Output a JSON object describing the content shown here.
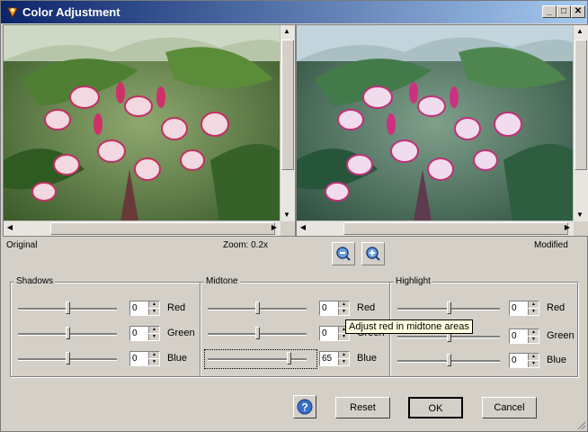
{
  "window": {
    "title": "Color Adjustment"
  },
  "titlebar_buttons": [
    "_",
    "□",
    "✕"
  ],
  "preview": {
    "left_caption": "Original",
    "zoom_label": "Zoom: 0.2x",
    "right_caption": "Modified"
  },
  "groups": {
    "shadows": {
      "label": "Shadows",
      "rows": [
        {
          "value": "0",
          "label": "Red",
          "level": 0.5
        },
        {
          "value": "0",
          "label": "Green",
          "level": 0.5
        },
        {
          "value": "0",
          "label": "Blue",
          "level": 0.5
        }
      ]
    },
    "midtone": {
      "label": "Midtone",
      "rows": [
        {
          "value": "0",
          "label": "Red",
          "level": 0.5
        },
        {
          "value": "0",
          "label": "Green",
          "level": 0.5
        },
        {
          "value": "65",
          "label": "Blue",
          "level": 0.82
        }
      ]
    },
    "highlight": {
      "label": "Highlight",
      "rows": [
        {
          "value": "0",
          "label": "Red",
          "level": 0.5
        },
        {
          "value": "0",
          "label": "Green",
          "level": 0.5
        },
        {
          "value": "0",
          "label": "Blue",
          "level": 0.5
        }
      ]
    }
  },
  "tooltip": "Adjust red in midtone areas",
  "buttons": {
    "reset": "Reset",
    "ok": "OK",
    "cancel": "Cancel"
  },
  "colors": {
    "title_start": "#0a246a",
    "title_end": "#a6caf0",
    "face": "#d4d0c8"
  }
}
